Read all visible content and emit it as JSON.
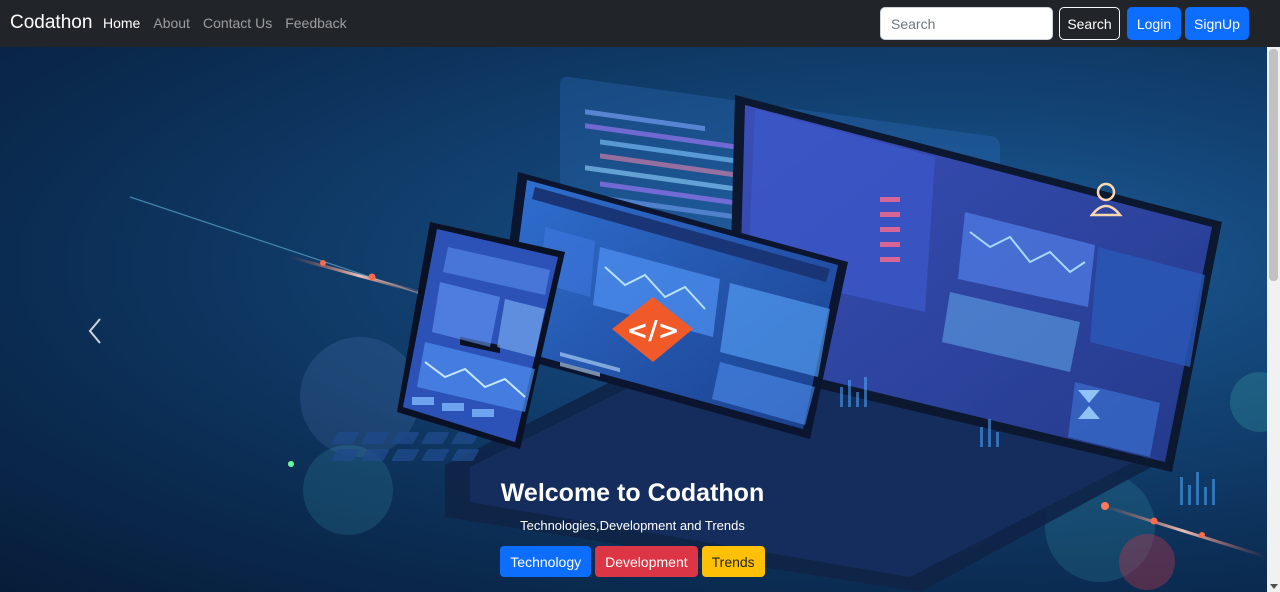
{
  "navbar": {
    "brand": "Codathon",
    "links": [
      "Home",
      "About",
      "Contact Us",
      "Feedback"
    ],
    "search_placeholder": "Search",
    "search_button": "Search",
    "login_button": "Login",
    "signup_button": "SignUp"
  },
  "hero": {
    "title": "Welcome to Codathon",
    "subtitle": "Technologies,Development and Trends",
    "tags": [
      "Technology",
      "Development",
      "Trends"
    ],
    "code_badge": "</>"
  },
  "colors": {
    "navbar_bg": "#212529",
    "primary": "#0d6efd",
    "danger": "#dc3545",
    "warning": "#ffc107",
    "badge": "#f05a28"
  }
}
